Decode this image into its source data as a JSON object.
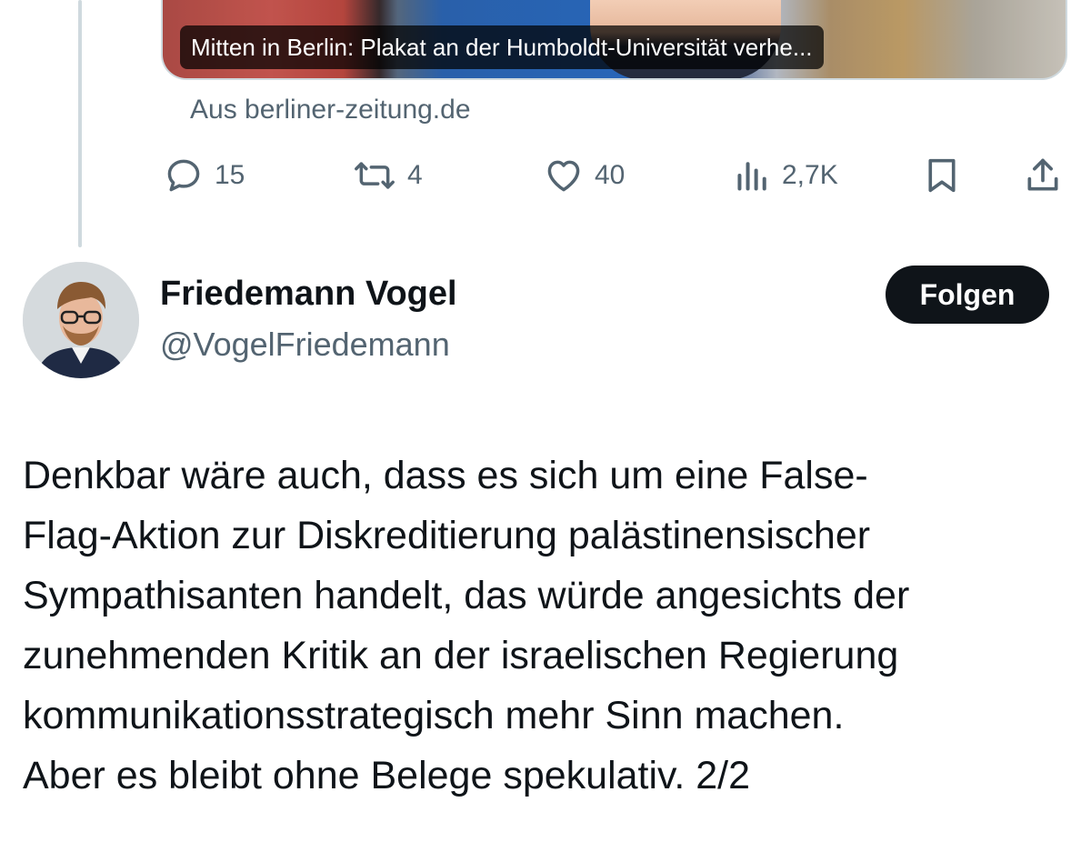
{
  "previous_tweet": {
    "link_card": {
      "caption": "Mitten in Berlin: Plakat an der Humboldt-Universität verhe...",
      "source": "Aus berliner-zeitung.de"
    },
    "actions": {
      "replies": "15",
      "reposts": "4",
      "likes": "40",
      "views": "2,7K"
    }
  },
  "tweet": {
    "author": {
      "name": "Friedemann Vogel",
      "handle": "@VogelFriedemann"
    },
    "follow_label": "Folgen",
    "body_lines": [
      "Denkbar wäre auch, dass es sich um eine False-",
      "Flag-Aktion zur Diskreditierung palästinensischer",
      "Sympathisanten handelt, das würde angesichts der",
      "zunehmenden Kritik an der israelischen Regierung",
      "kommunikationsstrategisch mehr Sinn machen.",
      "Aber es bleibt ohne Belege spekulativ. 2/2"
    ]
  },
  "icons": {
    "reply": "reply-icon",
    "repost": "repost-icon",
    "like": "heart-icon",
    "views": "views-icon",
    "bookmark": "bookmark-icon",
    "share": "share-icon"
  },
  "colors": {
    "text_primary": "#0f1419",
    "text_secondary": "#536471",
    "divider": "#cfd9de",
    "follow_button_bg": "#0f1419"
  }
}
